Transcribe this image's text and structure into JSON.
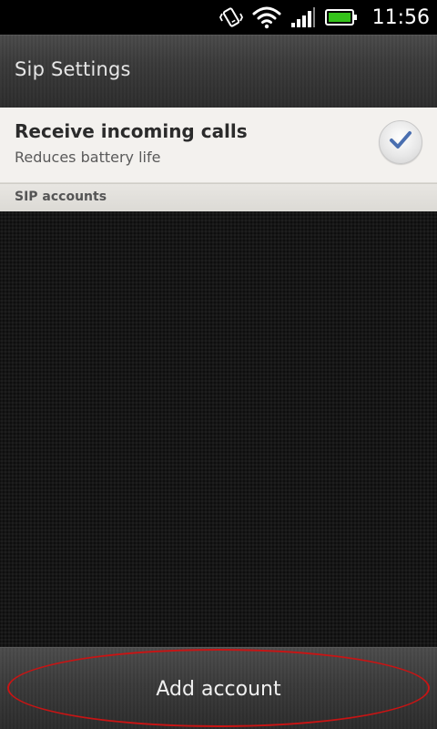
{
  "status_bar": {
    "time": "11:56",
    "icons": [
      "vibrate-icon",
      "wifi-icon",
      "signal-icon",
      "battery-icon"
    ],
    "battery_color": "#34c21a"
  },
  "header": {
    "title": "Sip Settings"
  },
  "settings": {
    "receive_calls": {
      "title": "Receive incoming calls",
      "subtitle": "Reduces battery life",
      "checked": true
    }
  },
  "sections": {
    "sip_accounts_label": "SIP accounts"
  },
  "footer": {
    "add_account_label": "Add account",
    "highlight_color": "#c81414"
  }
}
